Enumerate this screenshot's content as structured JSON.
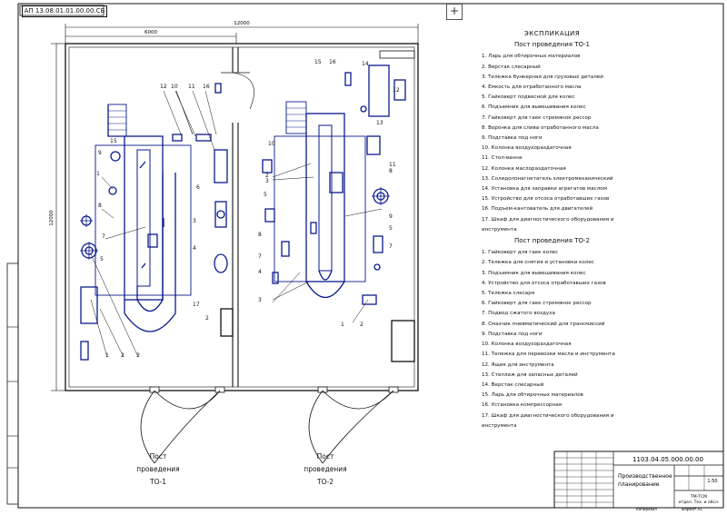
{
  "stamp": "АП 13.08.01.01.00.00.СБ",
  "dims": {
    "overall": "12000",
    "half": "6000",
    "height": "12000"
  },
  "explication": {
    "heading": "ЭКСПЛИКАЦИЯ",
    "post1_title": "Пост проведения ТО-1",
    "post1_items": [
      "1. Ларь для обтирочных материалов",
      "2. Верстак слесарный",
      "3. Тележка бункерная для грузовых деталей",
      "4. Емкость для отработанного масла",
      "5. Гайковерт подвесной для колес",
      "6. Подъемник для вывешивания колес",
      "7. Гайковерт для гаек стремянок рессор",
      "8. Воронка для слива отработанного масла",
      "9. Подставка под ноги",
      "10. Колонка воздухораздаточная",
      "11. Стол-ванна",
      "12. Колонка маслораздаточная",
      "13. Солидолонагнетатель электромеханический",
      "14. Установка для заправки агрегатов маслом",
      "15. Устройство для отсоса отработавших газов",
      "16. Подъем-кантователь для двигателей",
      "17. Шкаф для диагностического оборудования и инструмента"
    ],
    "post2_title": "Пост проведения ТО-2",
    "post2_items": [
      "1. Гайковерт для гаек колес",
      "2. Тележка для снятия и установки колес",
      "3. Подъемник для вывешивания колес",
      "4. Устройство для отсоса отработавших газов",
      "5. Тележка слесаря",
      "6. Гайковерт для гаек стремянок рессор",
      "7. Подвод сжатого воздуха",
      "8. Смазчик пневматический для трансмиссий",
      "9. Подставка под ноги",
      "10. Колонка воздухораздаточная",
      "11. Тележка для перевозки масла и инструмента",
      "12. Ящик для инструмента",
      "13. Стеллаж для запасных деталей",
      "14. Верстак слесарный",
      "15. Ларь для обтирочных материалов",
      "16. Установка компрессорная",
      "17. Шкаф для диагностического оборудования и инструмента"
    ]
  },
  "posts": {
    "to1_line1": "Пост",
    "to1_line2": "проведения",
    "to1_line3": "ТО-1",
    "to2_line1": "Пост",
    "to2_line2": "проведения",
    "to2_line3": "ТО-2"
  },
  "title_block": {
    "code": "1103.04.05.000.00.00",
    "title_line1": "Производственное",
    "title_line2": "планирование",
    "scale": "1:50",
    "org_line1": "ТМ-ТСМ",
    "org_line2": "отдел. Тех. и обсл.",
    "copied": "Копировал",
    "format": "Формат А1"
  },
  "callouts": {
    "p1": [
      "12",
      "10",
      "11",
      "16",
      "15",
      "9",
      "1",
      "8",
      "7",
      "6",
      "3",
      "4",
      "5",
      "2",
      "1",
      "2",
      "3",
      "4",
      "5",
      "6",
      "7",
      "8",
      "17"
    ],
    "p2": [
      "15",
      "16",
      "14",
      "13",
      "10",
      "12",
      "2",
      "3",
      "8",
      "11",
      "5",
      "8",
      "7",
      "6",
      "4",
      "3",
      "9",
      "5",
      "7",
      "1",
      "2"
    ]
  },
  "colors": {
    "equipment": "#0a1a8c",
    "lines": "#111111",
    "background": "#ffffff"
  }
}
